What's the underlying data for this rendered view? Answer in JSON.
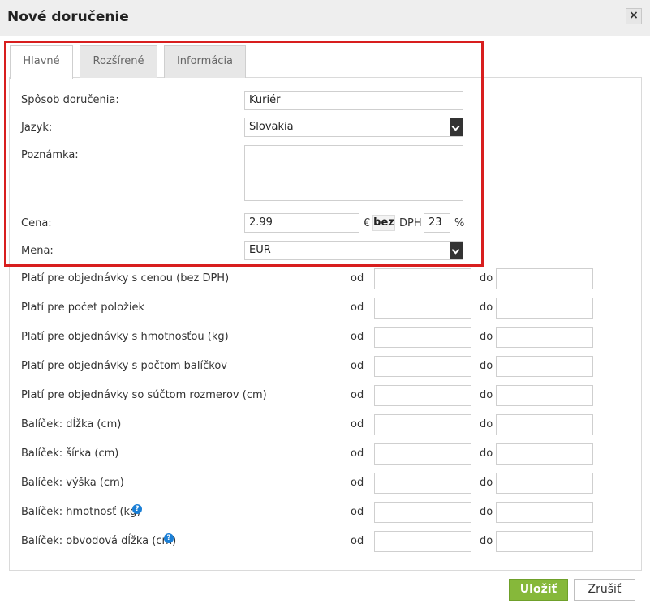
{
  "dialog": {
    "title": "Nové doručenie",
    "close_label": "×"
  },
  "tabs": [
    {
      "label": "Hlavné"
    },
    {
      "label": "Rozšírené"
    },
    {
      "label": "Informácia"
    }
  ],
  "form": {
    "delivery_method": {
      "label": "Spôsob doručenia:",
      "value": "Kuriér"
    },
    "language": {
      "label": "Jazyk:",
      "value": "Slovakia"
    },
    "note": {
      "label": "Poznámka:",
      "value": ""
    },
    "price": {
      "label": "Cena:",
      "value": "2.99",
      "currency_symbol": "€",
      "tax_mode": "bez",
      "tax_label": "DPH",
      "tax_value": "23",
      "percent": "%"
    },
    "currency": {
      "label": "Mena:",
      "value": "EUR"
    }
  },
  "ranges": {
    "from_label": "od",
    "to_label": "do",
    "rows": [
      {
        "label": "Platí pre objednávky s cenou (bez DPH)",
        "help": false
      },
      {
        "label": "Platí pre počet položiek",
        "help": false
      },
      {
        "label": "Platí pre objednávky s hmotnosťou (kg)",
        "help": false
      },
      {
        "label": "Platí pre objednávky s počtom balíčkov",
        "help": false
      },
      {
        "label": "Platí pre objednávky so súčtom rozmerov (cm)",
        "help": false
      },
      {
        "label": "Balíček: dĺžka (cm)",
        "help": false
      },
      {
        "label": "Balíček: šírka (cm)",
        "help": false
      },
      {
        "label": "Balíček: výška (cm)",
        "help": false
      },
      {
        "label": "Balíček: hmotnosť (kg)",
        "help": true
      },
      {
        "label": "Balíček: obvodová dĺžka (cm)",
        "help": true
      }
    ]
  },
  "footer": {
    "save_label": "Uložiť",
    "cancel_label": "Zrušiť"
  },
  "colors": {
    "accent_green": "#86b83a",
    "highlight_red": "#d81e1e",
    "help_blue": "#1a7fd6"
  },
  "icons": {
    "close": "close-icon",
    "select": "chevron-down-icon",
    "help": "help-icon"
  }
}
